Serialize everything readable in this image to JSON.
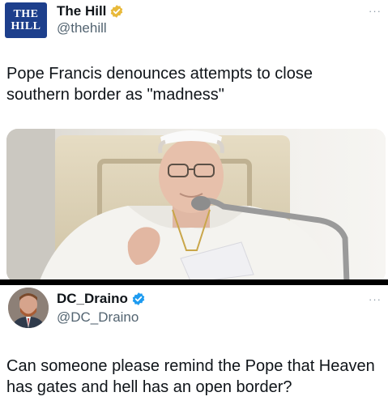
{
  "tweet1": {
    "avatar_lines": [
      "THE",
      "HILL"
    ],
    "display_name": "The Hill",
    "handle": "@thehill",
    "more_label": "···",
    "text_lines": [
      "Pope Francis denounces attempts to close",
      "southern border as \"madness\""
    ],
    "badge": "gold-verified-badge-icon"
  },
  "tweet2": {
    "display_name": "DC_Draino",
    "handle": "@DC_Draino",
    "more_label": "···",
    "text_lines": [
      "Can someone please remind the Pope that Heaven",
      "has gates and hell has an open border?"
    ],
    "badge": "blue-verified-badge-icon"
  },
  "colors": {
    "hill_blue": "#1d3f8c",
    "gold_badge": "#e8b93a",
    "blue_badge": "#1d9bf0",
    "text_primary": "#0f1419",
    "text_secondary": "#536471",
    "divider": "#000000"
  }
}
